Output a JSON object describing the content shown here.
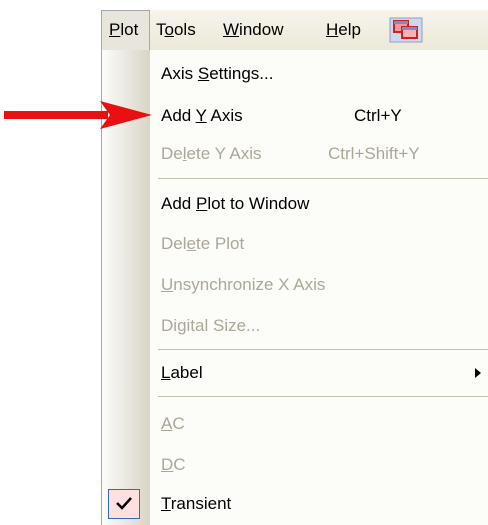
{
  "menubar": {
    "items": [
      {
        "label_pre": "",
        "label_ul": "P",
        "label_post": "lot"
      },
      {
        "label_pre": "T",
        "label_ul": "o",
        "label_post": "ols"
      },
      {
        "label_pre": "",
        "label_ul": "W",
        "label_post": "indow"
      },
      {
        "label_pre": "",
        "label_ul": "H",
        "label_post": "elp"
      }
    ],
    "app_icon": "overlapping-windows-icon"
  },
  "menu": {
    "items": [
      {
        "pre": "Axis ",
        "ul": "S",
        "post": "ettings...",
        "shortcut": "",
        "enabled": true
      },
      {
        "pre": "Add ",
        "ul": "Y",
        "post": " Axis",
        "shortcut": "Ctrl+Y",
        "enabled": true
      },
      {
        "pre": "De",
        "ul": "l",
        "post": "ete Y Axis",
        "shortcut": "Ctrl+Shift+Y",
        "enabled": false
      },
      {
        "pre": "Add ",
        "ul": "P",
        "post": "lot to Window",
        "shortcut": "",
        "enabled": true
      },
      {
        "pre": "Del",
        "ul": "e",
        "post": "te Plot",
        "shortcut": "",
        "enabled": false
      },
      {
        "pre": "",
        "ul": "U",
        "post": "nsynchronize X Axis",
        "shortcut": "",
        "enabled": false
      },
      {
        "pre": "Di",
        "ul": "g",
        "post": "ital Size...",
        "shortcut": "",
        "enabled": false
      },
      {
        "pre": "",
        "ul": "L",
        "post": "abel",
        "shortcut": "",
        "enabled": true,
        "submenu": true
      },
      {
        "pre": "",
        "ul": "A",
        "post": "C",
        "shortcut": "",
        "enabled": false
      },
      {
        "pre": "",
        "ul": "D",
        "post": "C",
        "shortcut": "",
        "enabled": false
      },
      {
        "pre": "",
        "ul": "T",
        "post": "ransient",
        "shortcut": "",
        "enabled": true,
        "checked": true
      }
    ]
  },
  "annotation": {
    "arrow_color": "#e81010",
    "icon": "red-arrow-icon"
  }
}
